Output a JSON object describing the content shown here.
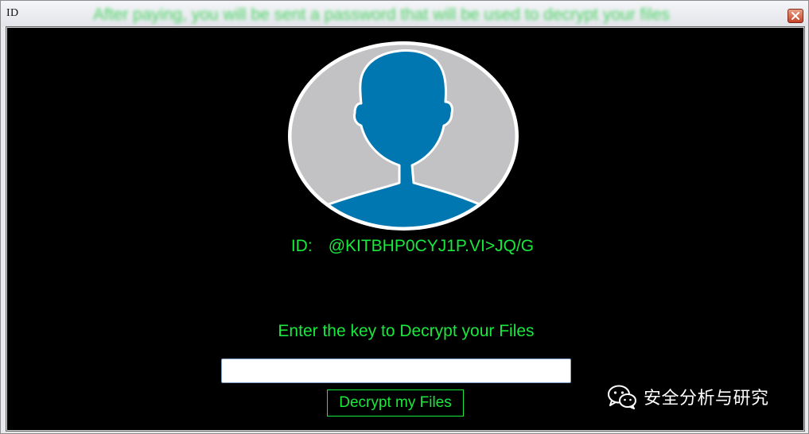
{
  "window": {
    "title": "ID",
    "banner_text": "After paying, you will be sent a password that will be used to decrypt your files"
  },
  "id_display": {
    "label": "ID:",
    "value": "@KITBHP0CYJ1P.VI>JQ/G"
  },
  "decrypt": {
    "prompt": "Enter the key to Decrypt your Files",
    "input_value": "",
    "input_placeholder": "",
    "button_label": "Decrypt my Files"
  },
  "watermark": {
    "text": "安全分析与研究",
    "icon": "wechat-icon"
  },
  "colors": {
    "accent_green": "#19e83d",
    "background": "#000000",
    "avatar_blue": "#0077b0",
    "avatar_gray": "#c2c2c4",
    "close_red": "#c84326"
  },
  "icons": {
    "avatar": "user-silhouette-icon",
    "close": "close-icon"
  }
}
